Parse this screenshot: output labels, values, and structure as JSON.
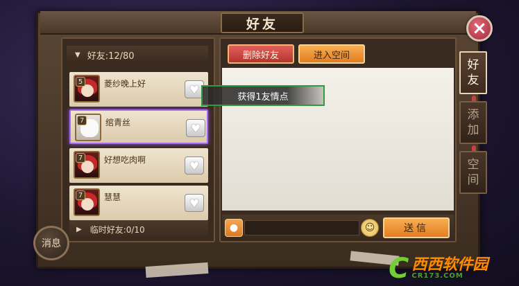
{
  "title": "好友",
  "friends_header": {
    "label": "好友:12/80"
  },
  "friends": [
    {
      "name": "菱纱晚上好",
      "level": "5"
    },
    {
      "name": "绾青丝",
      "level": "7"
    },
    {
      "name": "好想吃肉啊",
      "level": "7"
    },
    {
      "name": "慧慧",
      "level": "7"
    }
  ],
  "temp_friends": {
    "label": "临时好友:0/10"
  },
  "message_button": "消息",
  "actions": {
    "delete_friend": "删除好友",
    "enter_space": "进入空间"
  },
  "toast": "获得1友情点",
  "chat": {
    "send": "送信",
    "placeholder": ""
  },
  "side_tabs": [
    {
      "label": "好\n友",
      "active": true
    },
    {
      "label": "添\n加",
      "active": false
    },
    {
      "label": "空\n间",
      "active": false
    }
  ],
  "icons": {
    "close": "close-icon",
    "heart": "heart-icon",
    "mic": "mic-icon",
    "emoji": "emoji-icon",
    "expand": "triangle-icon"
  },
  "colors": {
    "selected_outline": "#a86cf0",
    "toast_border": "#2e9b3c",
    "delete_button": "#c8423c",
    "orange_button": "#f09a3c"
  },
  "watermark": {
    "brand": "西西软件园",
    "url": "CR173.COM"
  }
}
